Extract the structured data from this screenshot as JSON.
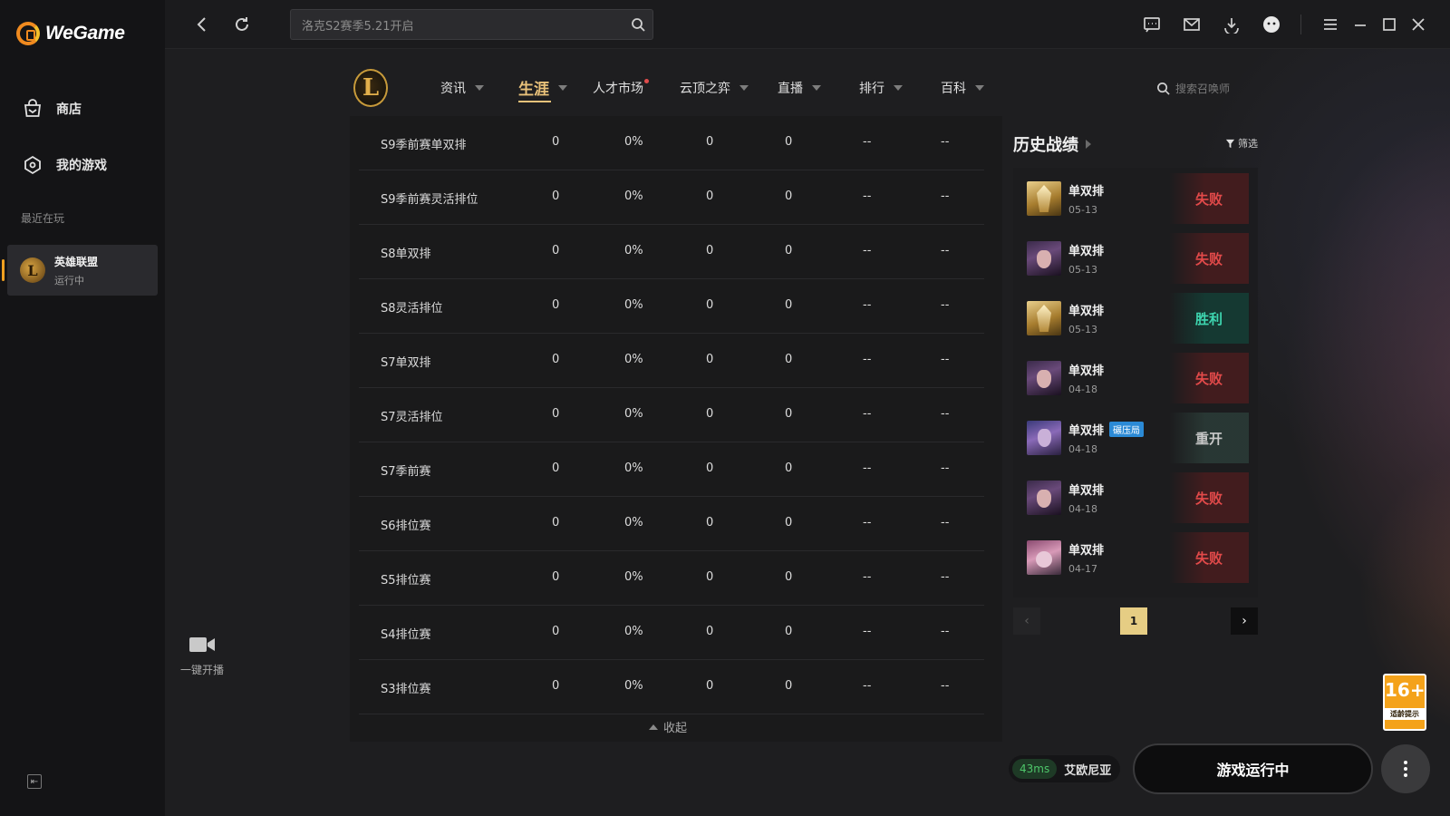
{
  "app": {
    "brand": "WeGame"
  },
  "sidebar": {
    "items": [
      {
        "label": "商店",
        "icon": "store-icon"
      },
      {
        "label": "我的游戏",
        "icon": "my-games-icon"
      }
    ],
    "recent_label": "最近在玩",
    "recent_game": {
      "name": "英雄联盟",
      "status": "运行中",
      "icon_glyph": "L"
    },
    "stream_label": "一键开播"
  },
  "topbar": {
    "search_placeholder": "洛克S2赛季5.21开启"
  },
  "game_nav": {
    "logo_glyph": "L",
    "items": [
      {
        "label": "资讯"
      },
      {
        "label": "生涯"
      },
      {
        "label": "人才市场"
      },
      {
        "label": "云顶之弈"
      },
      {
        "label": "直播"
      },
      {
        "label": "排行"
      },
      {
        "label": "百科"
      }
    ],
    "active_index": 1,
    "summoner_search_placeholder": "搜索召唤师"
  },
  "stats_table": {
    "rows": [
      {
        "name": "S9季前赛单双排",
        "c1": "0",
        "c2": "0%",
        "c3": "0",
        "c4": "0",
        "c5": "--",
        "c6": "--"
      },
      {
        "name": "S9季前赛灵活排位",
        "c1": "0",
        "c2": "0%",
        "c3": "0",
        "c4": "0",
        "c5": "--",
        "c6": "--"
      },
      {
        "name": "S8单双排",
        "c1": "0",
        "c2": "0%",
        "c3": "0",
        "c4": "0",
        "c5": "--",
        "c6": "--"
      },
      {
        "name": "S8灵活排位",
        "c1": "0",
        "c2": "0%",
        "c3": "0",
        "c4": "0",
        "c5": "--",
        "c6": "--"
      },
      {
        "name": "S7单双排",
        "c1": "0",
        "c2": "0%",
        "c3": "0",
        "c4": "0",
        "c5": "--",
        "c6": "--"
      },
      {
        "name": "S7灵活排位",
        "c1": "0",
        "c2": "0%",
        "c3": "0",
        "c4": "0",
        "c5": "--",
        "c6": "--"
      },
      {
        "name": "S7季前赛",
        "c1": "0",
        "c2": "0%",
        "c3": "0",
        "c4": "0",
        "c5": "--",
        "c6": "--"
      },
      {
        "name": "S6排位赛",
        "c1": "0",
        "c2": "0%",
        "c3": "0",
        "c4": "0",
        "c5": "--",
        "c6": "--"
      },
      {
        "name": "S5排位赛",
        "c1": "0",
        "c2": "0%",
        "c3": "0",
        "c4": "0",
        "c5": "--",
        "c6": "--"
      },
      {
        "name": "S4排位赛",
        "c1": "0",
        "c2": "0%",
        "c3": "0",
        "c4": "0",
        "c5": "--",
        "c6": "--"
      },
      {
        "name": "S3排位赛",
        "c1": "0",
        "c2": "0%",
        "c3": "0",
        "c4": "0",
        "c5": "--",
        "c6": "--"
      }
    ],
    "collapse_label": "收起"
  },
  "history": {
    "title": "历史战绩",
    "filter_label": "筛选",
    "matches": [
      {
        "mode": "单双排",
        "date": "05-13",
        "result": "失败",
        "result_type": "lose",
        "avatar": "av-gold",
        "badge": ""
      },
      {
        "mode": "单双排",
        "date": "05-13",
        "result": "失败",
        "result_type": "lose",
        "avatar": "av-dark",
        "badge": ""
      },
      {
        "mode": "单双排",
        "date": "05-13",
        "result": "胜利",
        "result_type": "win",
        "avatar": "av-gold",
        "badge": ""
      },
      {
        "mode": "单双排",
        "date": "04-18",
        "result": "失败",
        "result_type": "lose",
        "avatar": "av-dark",
        "badge": ""
      },
      {
        "mode": "单双排",
        "date": "04-18",
        "result": "重开",
        "result_type": "remake",
        "avatar": "av-blue",
        "badge": "碾压局"
      },
      {
        "mode": "单双排",
        "date": "04-18",
        "result": "失败",
        "result_type": "lose",
        "avatar": "av-dark",
        "badge": ""
      },
      {
        "mode": "单双排",
        "date": "04-17",
        "result": "失败",
        "result_type": "lose",
        "avatar": "av-pink",
        "badge": ""
      }
    ],
    "pager": {
      "current": "1"
    }
  },
  "bottom": {
    "ping": "43ms",
    "server": "艾欧尼亚",
    "launch_label": "游戏运行中",
    "age_rating": "16+",
    "age_note": "适龄提示"
  },
  "colors": {
    "accent": "#e9c27a",
    "lose": "#e24a4a",
    "win": "#3ed6b0",
    "ping": "#4ec66a",
    "age": "#f4a21a"
  }
}
